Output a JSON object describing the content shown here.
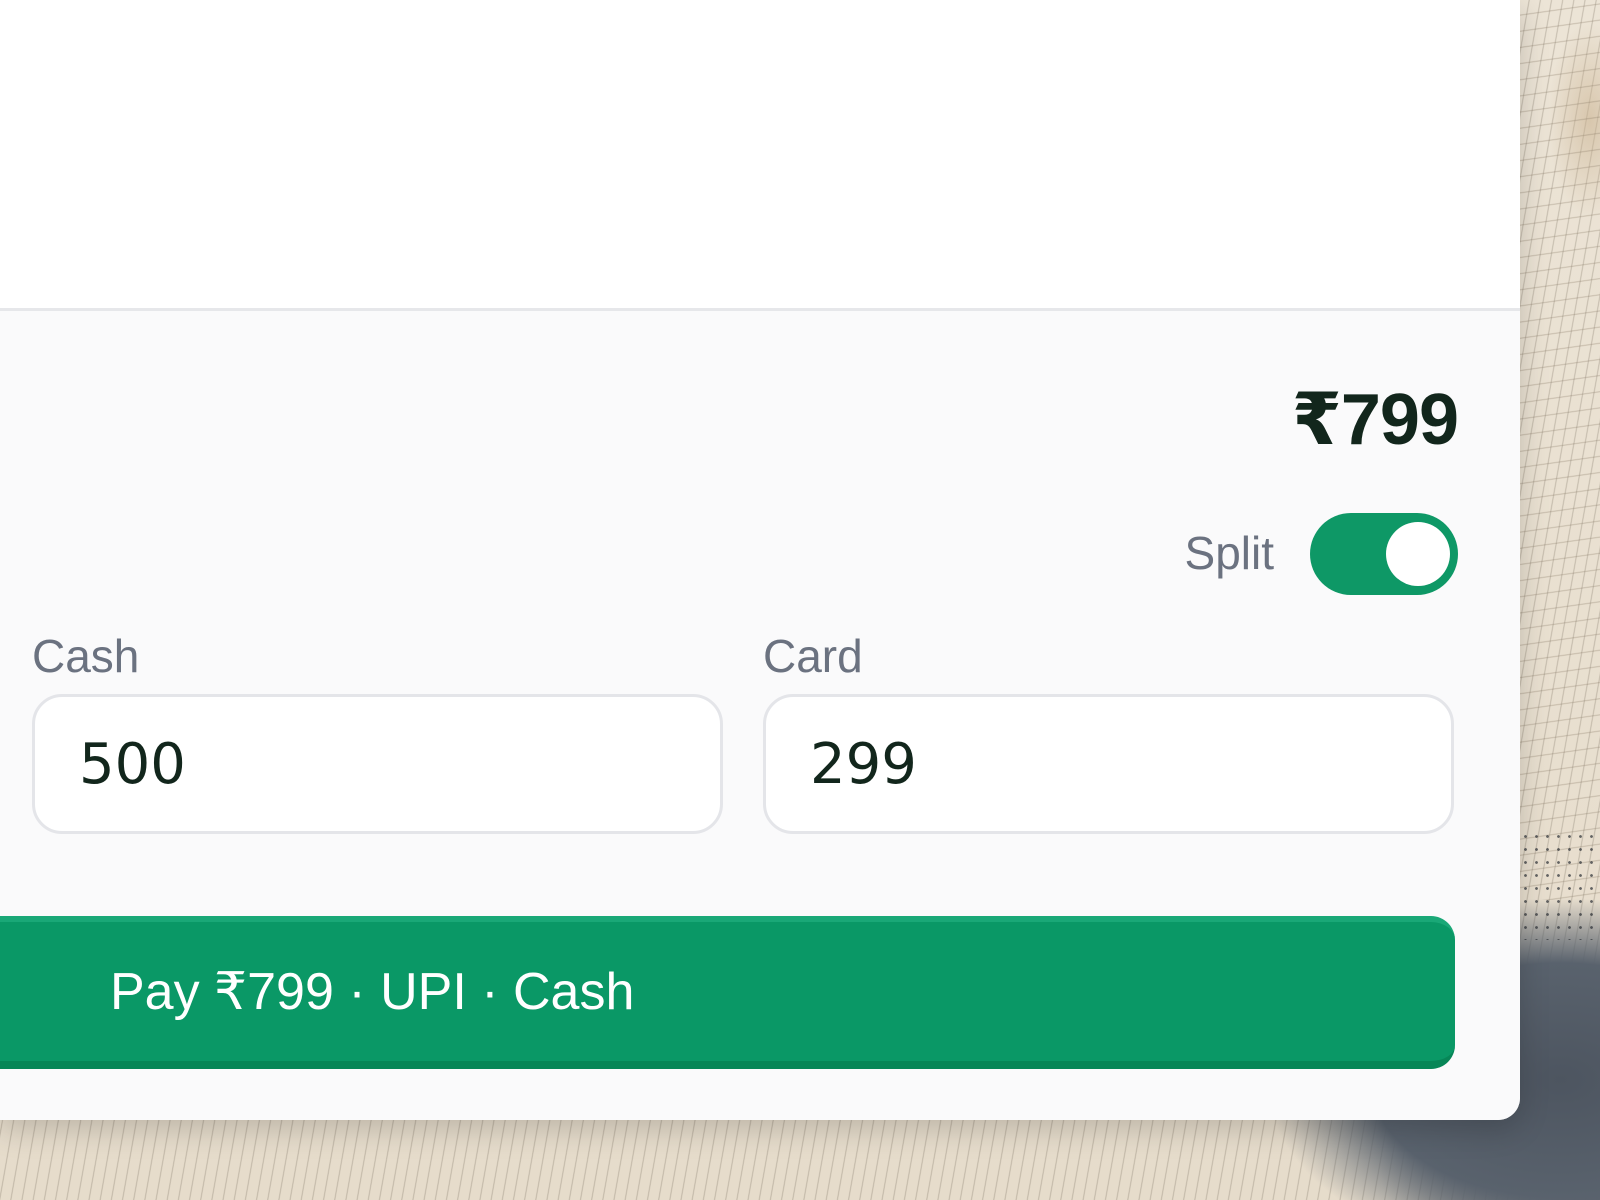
{
  "checkout": {
    "total": "₹799",
    "split": {
      "label": "Split",
      "enabled": true
    },
    "cash": {
      "label": "Cash",
      "value": "500"
    },
    "card": {
      "label": "Card",
      "value": "299"
    },
    "pay_button_label": "Pay ₹799 · UPI · Cash"
  },
  "colors": {
    "accent": "#0a9866",
    "total_text": "#12261c",
    "muted_text": "#6b7280"
  }
}
